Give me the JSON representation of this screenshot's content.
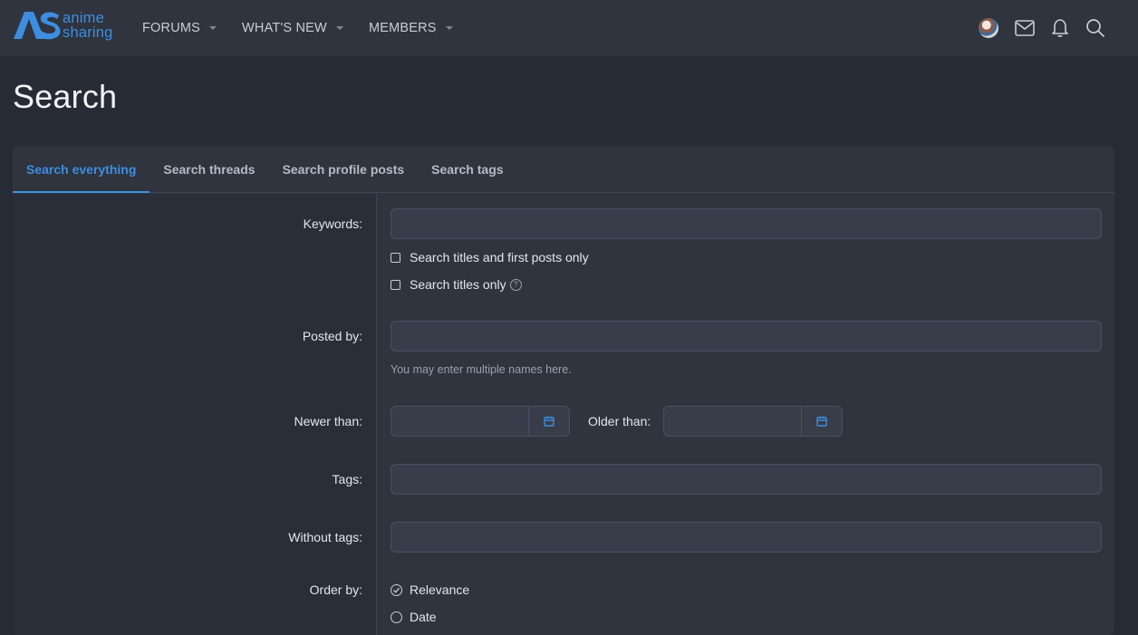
{
  "header": {
    "logo": {
      "line1": "anime",
      "line2": "sharing"
    },
    "nav": [
      {
        "label": "FORUMS"
      },
      {
        "label": "WHAT'S NEW"
      },
      {
        "label": "MEMBERS"
      }
    ],
    "icons": [
      "avatar",
      "envelope-icon",
      "bell-icon",
      "search-icon"
    ]
  },
  "page": {
    "title": "Search"
  },
  "tabs": [
    {
      "label": "Search everything",
      "active": true
    },
    {
      "label": "Search threads",
      "active": false
    },
    {
      "label": "Search profile posts",
      "active": false
    },
    {
      "label": "Search tags",
      "active": false
    }
  ],
  "form": {
    "keywords": {
      "label": "Keywords:",
      "value": ""
    },
    "options": [
      {
        "label": "Search titles and first posts only",
        "checked": false
      },
      {
        "label": "Search titles only",
        "checked": false,
        "help_icon": "question-circle-icon"
      }
    ],
    "posted_by": {
      "label": "Posted by:",
      "value": "",
      "hint": "You may enter multiple names here."
    },
    "newer_than": {
      "label": "Newer than:",
      "value": ""
    },
    "older_than": {
      "label": "Older than:",
      "value": ""
    },
    "tags": {
      "label": "Tags:",
      "value": ""
    },
    "without_tags": {
      "label": "Without tags:",
      "value": ""
    },
    "order_by": {
      "label": "Order by:",
      "options": [
        {
          "label": "Relevance",
          "selected": true
        },
        {
          "label": "Date",
          "selected": false
        }
      ]
    }
  },
  "colors": {
    "accent": "#3d8ee0",
    "background": "#272b35",
    "panel": "#2f343f"
  }
}
